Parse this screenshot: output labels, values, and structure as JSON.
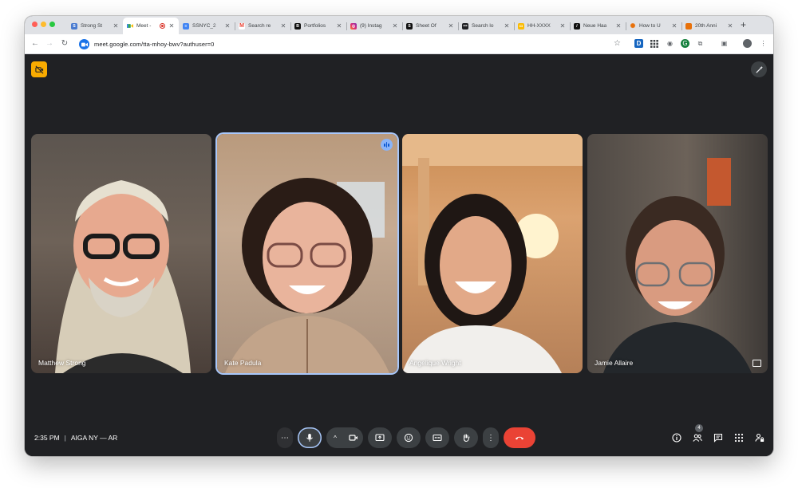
{
  "browser": {
    "tabs": [
      {
        "title": "Strong St",
        "favicon_color": "#4a7bd0",
        "active": false
      },
      {
        "title": "Meet -",
        "favicon_color": "#34a853",
        "active": true,
        "recording": true
      },
      {
        "title": "SSNYC_2",
        "favicon_color": "#4285f4",
        "active": false
      },
      {
        "title": "Search re",
        "favicon_color": "#ea4335",
        "active": false
      },
      {
        "title": "Portfolios",
        "favicon_color": "#111111",
        "active": false
      },
      {
        "title": "(9) Instag",
        "favicon_color": "#c13584",
        "active": false
      },
      {
        "title": "Sheet Of",
        "favicon_color": "#111111",
        "active": false
      },
      {
        "title": "Search lo",
        "favicon_color": "#202124",
        "active": false
      },
      {
        "title": "HH-XXXX",
        "favicon_color": "#fbbc04",
        "active": false
      },
      {
        "title": "Neue Haa",
        "favicon_color": "#111111",
        "active": false
      },
      {
        "title": "How to U",
        "favicon_color": "#e8710a",
        "active": false
      },
      {
        "title": "20th Anni",
        "favicon_color": "#e8710a",
        "active": false
      }
    ],
    "url": "meet.google.com/tta-mhoy-bwv?authuser=0"
  },
  "meet": {
    "participants": [
      {
        "name": "Matthew Strong",
        "speaking": false
      },
      {
        "name": "Kate Padula",
        "speaking": true
      },
      {
        "name": "Angelique Wright",
        "speaking": false
      },
      {
        "name": "Jamie Allaire",
        "speaking": false
      }
    ],
    "time": "2:35 PM",
    "separator": "|",
    "meeting_name": "AIGA NY — AR",
    "people_count": "4"
  },
  "colors": {
    "background": "#202124",
    "control": "#3c4043",
    "hangup": "#ea4335",
    "accent": "#a8c7fa",
    "warning": "#f9ab00"
  }
}
